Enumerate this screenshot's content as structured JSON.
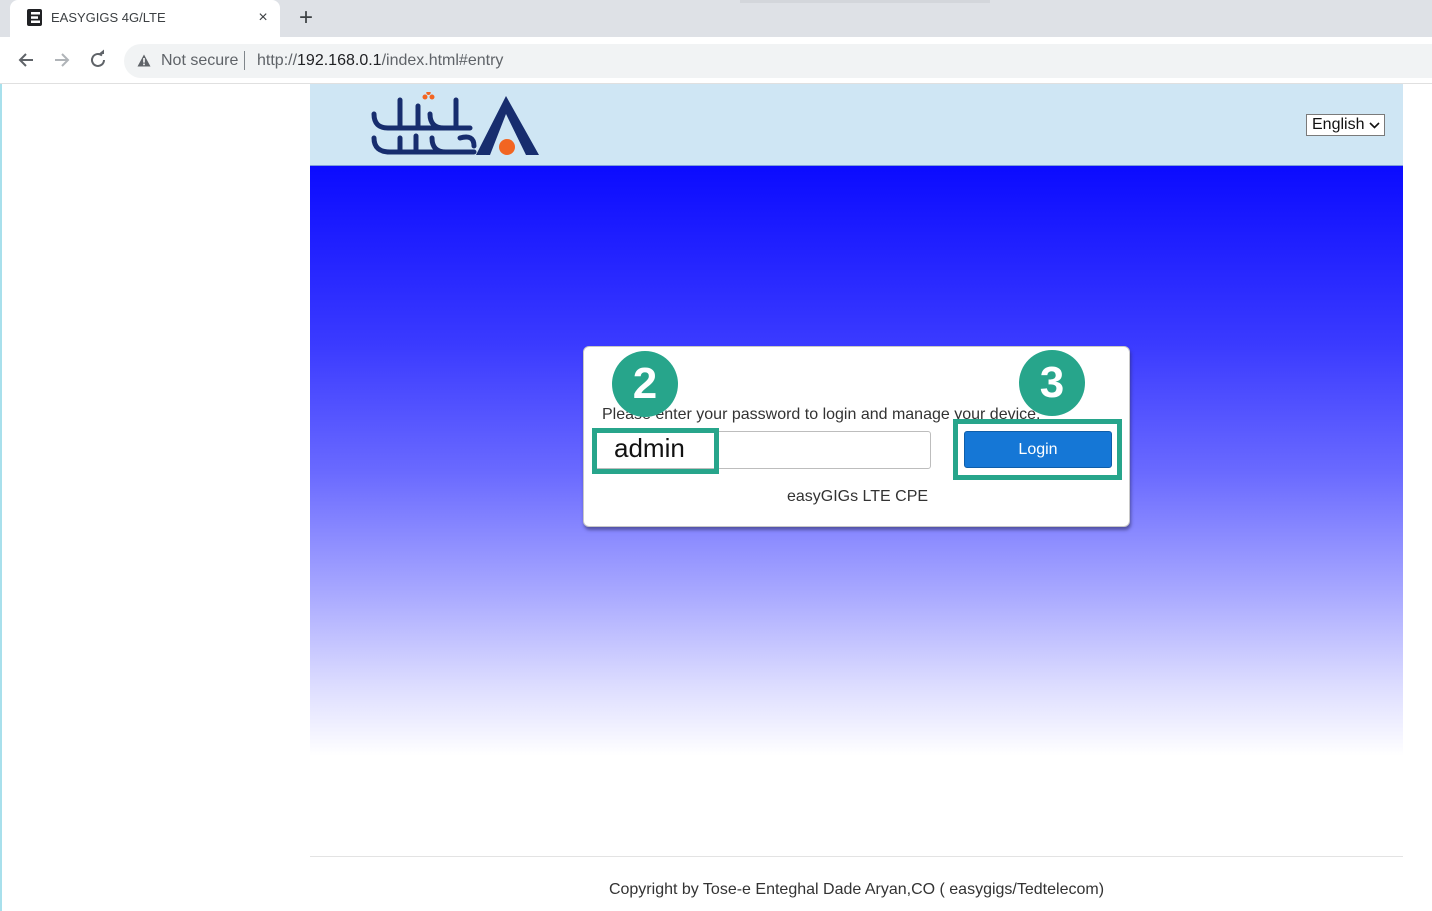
{
  "browser": {
    "tab_title": "EASYGIGS 4G/LTE",
    "tab_close": "×",
    "new_tab": "+",
    "security_label": "Not secure",
    "url_scheme": "http://",
    "url_host": "192.168.0.1",
    "url_path": "/index.html#entry"
  },
  "header": {
    "language": "English"
  },
  "login": {
    "instruction": "Please enter your password to login and manage your device.",
    "password_value": "admin",
    "login_label": "Login",
    "device_name": "easyGIGs LTE CPE"
  },
  "annotations": {
    "step_2": "2",
    "step_3": "3",
    "highlight_color": "#27a58b"
  },
  "footer": {
    "copyright": "Copyright by Tose-e Enteghal Dade Aryan,CO ( easygigs/Tedtelecom)"
  },
  "colors": {
    "brand_navy": "#172d6e",
    "brand_orange": "#f26522",
    "button_blue": "#1577d6",
    "header_band": "#cfe6f4"
  }
}
